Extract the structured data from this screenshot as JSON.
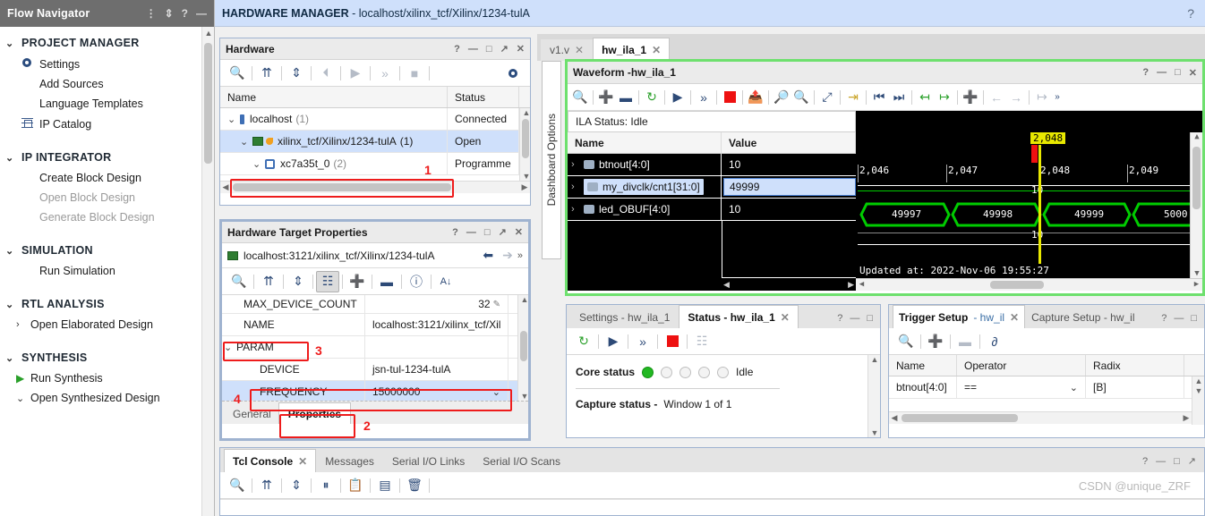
{
  "flow_navigator": {
    "title": "Flow Navigator",
    "title_icons": [
      "collapse-all-icon",
      "expand-collapse-icon",
      "help-icon",
      "minimize-icon"
    ],
    "sections": [
      {
        "label": "PROJECT MANAGER",
        "items": [
          {
            "label": "Settings",
            "icon": "gear-icon",
            "disabled": false
          },
          {
            "label": "Add Sources",
            "icon": "none",
            "disabled": false
          },
          {
            "label": "Language Templates",
            "icon": "none",
            "disabled": false
          },
          {
            "label": "IP Catalog",
            "icon": "ip-catalog-icon",
            "disabled": false
          }
        ]
      },
      {
        "label": "IP INTEGRATOR",
        "items": [
          {
            "label": "Create Block Design",
            "icon": "none",
            "disabled": false
          },
          {
            "label": "Open Block Design",
            "icon": "none",
            "disabled": true
          },
          {
            "label": "Generate Block Design",
            "icon": "none",
            "disabled": true
          }
        ]
      },
      {
        "label": "SIMULATION",
        "items": [
          {
            "label": "Run Simulation",
            "icon": "none",
            "disabled": false
          }
        ]
      },
      {
        "label": "RTL ANALYSIS",
        "items": [
          {
            "label": "Open Elaborated Design",
            "icon": "chevron-right-icon",
            "disabled": false
          }
        ]
      },
      {
        "label": "SYNTHESIS",
        "items": [
          {
            "label": "Run Synthesis",
            "icon": "play-icon",
            "disabled": false
          },
          {
            "label": "Open Synthesized Design",
            "icon": "chevron-down-icon",
            "disabled": false
          }
        ]
      }
    ]
  },
  "header": {
    "title_bold": "HARDWARE MANAGER",
    "title_rest": " - localhost/xilinx_tcf/Xilinx/1234-tulA",
    "help_icon": "help-icon"
  },
  "hardware_panel": {
    "title": "Hardware",
    "window_buttons": [
      "?",
      "—",
      "□",
      "↗",
      "✕"
    ],
    "toolbar": [
      "search-icon",
      "collapse-all-icon",
      "expand-all-icon",
      "refresh-target-icon",
      "run-trigger-icon",
      "run-more-icon",
      "stop-icon",
      "settings-gear-icon"
    ],
    "columns": [
      "Name",
      "Status"
    ],
    "rows": [
      {
        "name": "localhost",
        "count": "(1)",
        "status": "Connected",
        "indent": 0,
        "expanded": true,
        "icon": "server-icon",
        "selected": false
      },
      {
        "name": "xilinx_tcf/Xilinx/1234-tulA",
        "count": "(1)",
        "status": "Open",
        "indent": 1,
        "expanded": true,
        "icon": "target-icon",
        "selected": true
      },
      {
        "name": "xc7a35t_0",
        "count": "(2)",
        "status": "Programme",
        "indent": 2,
        "expanded": true,
        "icon": "device-icon",
        "selected": false
      }
    ]
  },
  "target_properties_panel": {
    "title": "Hardware Target Properties",
    "window_buttons": [
      "?",
      "—",
      "□",
      "↗",
      "✕"
    ],
    "target_name": "localhost:3121/xilinx_tcf/Xilinx/1234-tulA",
    "nav_back_icon": "arrow-left-icon",
    "nav_forward_icon": "arrow-right-icon",
    "more_icon": "chevron-double-right-icon",
    "toolbar": [
      "search-icon",
      "collapse-all-icon",
      "expand-all-icon",
      "group-tree-icon",
      "add-icon",
      "remove-icon",
      "info-icon",
      "sort-az-icon"
    ],
    "rows": [
      {
        "name": "MAX_DEVICE_COUNT",
        "value": "32",
        "indent": 1,
        "partial": true,
        "edit": true
      },
      {
        "name": "NAME",
        "value": "localhost:3121/xilinx_tcf/Xil",
        "indent": 1
      },
      {
        "name": "PARAM",
        "value": "",
        "indent": 0,
        "expanded": true
      },
      {
        "name": "DEVICE",
        "value": "jsn-tul-1234-tulA",
        "indent": 2
      },
      {
        "name": "FREQUENCY",
        "value": "15000000",
        "indent": 2,
        "selected": true,
        "dropdown": true
      }
    ],
    "tabs": [
      {
        "label": "General",
        "active": false
      },
      {
        "label": "Properties",
        "active": true
      }
    ]
  },
  "annotations": [
    {
      "number": "1",
      "target": "hardware-selected-row"
    },
    {
      "number": "2",
      "target": "properties-tab"
    },
    {
      "number": "3",
      "target": "param-row"
    },
    {
      "number": "4",
      "target": "frequency-row"
    }
  ],
  "editor_tabs": [
    {
      "label": "v1.v",
      "active": false,
      "closable": true
    },
    {
      "label": "hw_ila_1",
      "active": true,
      "closable": true
    }
  ],
  "dashboard_options": {
    "label": "Dashboard Options"
  },
  "waveform_panel": {
    "title_prefix": "Waveform - ",
    "title_name": "hw_ila_1",
    "window_buttons": [
      "?",
      "—",
      "□",
      "✕"
    ],
    "toolbar": [
      "search-icon",
      "zoom-add-icon",
      "zoom-remove-icon",
      "refresh-icon",
      "run-trigger-icon",
      "run-trigger-immediate-icon",
      "stop-icon",
      "export-icon",
      "zoom-in-icon",
      "zoom-out-icon",
      "zoom-fit-icon",
      "snap-to-edge-icon",
      "go-to-start-icon",
      "go-to-end-icon",
      "prev-transition-icon",
      "next-transition-icon",
      "add-marker-icon",
      "prev-marker-icon",
      "next-marker-icon",
      "measure-icon",
      "more-icon"
    ],
    "ila_status": "ILA Status: Idle",
    "columns": [
      "Name",
      "Value"
    ],
    "signals": [
      {
        "name": "btnout[4:0]",
        "value": "10",
        "selected": false,
        "icon": "bus-icon"
      },
      {
        "name": "my_divclk/cnt1[31:0]",
        "value": "49999",
        "selected": true,
        "icon": "bus-icon"
      },
      {
        "name": "led_OBUF[4:0]",
        "value": "10",
        "selected": false,
        "icon": "bus-icon"
      }
    ],
    "cursor_label": "2,048",
    "time_ticks": [
      "2,046",
      "2,047",
      "2,048",
      "2,049"
    ],
    "bus_values": [
      "49997",
      "49998",
      "49999",
      "5000"
    ],
    "wave_row_labels": [
      "10",
      "10"
    ],
    "updated_at": "Updated at: 2022-Nov-06 19:55:27"
  },
  "status_panel": {
    "tabs": [
      {
        "label": "Settings - hw_ila_1",
        "active": false,
        "closable": false
      },
      {
        "label": "Status - hw_ila_1",
        "active": true,
        "closable": true
      }
    ],
    "window_buttons": [
      "?",
      "—",
      "□"
    ],
    "toolbar": [
      "refresh-icon",
      "run-trigger-icon",
      "run-trigger-immediate-icon",
      "stop-icon",
      "auto-retrigger-icon"
    ],
    "core_status_label": "Core status",
    "core_status_value": "Idle",
    "core_status_dots": [
      true,
      false,
      false,
      false,
      false
    ],
    "capture_status_label": "Capture status -",
    "capture_status_value": "Window 1 of 1"
  },
  "trigger_panel": {
    "tabs": [
      {
        "label_bold": "Trigger Setup",
        "label_rest": " - hw_il",
        "active": true,
        "closable": true
      },
      {
        "label_bold": "",
        "label_rest": "Capture Setup - hw_il",
        "active": false,
        "closable": false
      }
    ],
    "window_buttons": [
      "?",
      "—",
      "□"
    ],
    "toolbar": [
      "search-icon",
      "add-probe-icon",
      "remove-probe-icon",
      "trigger-gate-icon"
    ],
    "columns": [
      "Name",
      "Operator",
      "Radix"
    ],
    "rows": [
      {
        "name": "btnout[4:0]",
        "operator": "==",
        "radix": "[B]"
      }
    ]
  },
  "console_panel": {
    "tabs": [
      {
        "label": "Tcl Console",
        "active": true,
        "closable": true
      },
      {
        "label": "Messages",
        "active": false,
        "closable": false
      },
      {
        "label": "Serial I/O Links",
        "active": false,
        "closable": false
      },
      {
        "label": "Serial I/O Scans",
        "active": false,
        "closable": false
      }
    ],
    "window_buttons": [
      "?",
      "—",
      "□",
      "↗"
    ],
    "toolbar": [
      "search-icon",
      "collapse-all-icon",
      "expand-all-icon",
      "pause-icon",
      "copy-icon",
      "report-icon",
      "clear-icon"
    ]
  },
  "watermark": {
    "text": "CSDN @unique_ZRF"
  },
  "colors": {
    "accent_blue": "#2d4a77",
    "selection": "#cfe0fb",
    "annotation_red": "#ee1c1c",
    "wave_green": "#00cc00",
    "highlight_green": "#6ee06e",
    "header_blue": "#cfe0fb",
    "stop_red": "#ee1111",
    "status_green": "#22b822",
    "cursor_yellow": "#e8e800"
  }
}
